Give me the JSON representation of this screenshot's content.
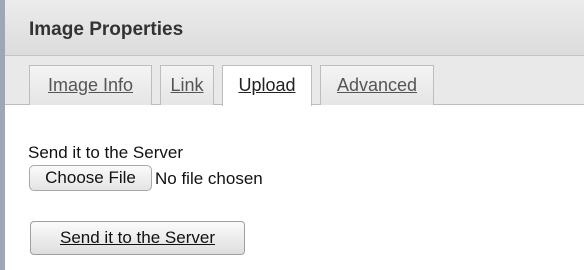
{
  "dialog": {
    "title": "Image Properties"
  },
  "tabs": [
    {
      "label": "Image Info",
      "active": false
    },
    {
      "label": "Link",
      "active": false
    },
    {
      "label": "Upload",
      "active": true
    },
    {
      "label": "Advanced",
      "active": false
    }
  ],
  "upload": {
    "field_label": "Send it to the Server",
    "choose_button": "Choose File",
    "file_status": "No file chosen",
    "send_button": "Send it to the Server"
  }
}
